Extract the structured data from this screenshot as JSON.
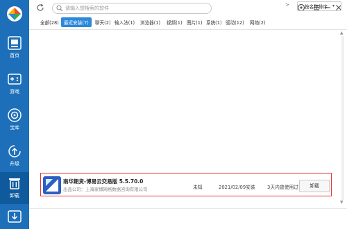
{
  "sidebar": {
    "items": [
      {
        "label": "首页"
      },
      {
        "label": "游戏"
      },
      {
        "label": "宝库"
      },
      {
        "label": "升级"
      },
      {
        "label": "卸载"
      }
    ]
  },
  "search": {
    "placeholder": "请输入想搜索的软件"
  },
  "tabs": [
    "全部(28)",
    "最近安装(7)",
    "聊天(2)",
    "输入法(1)",
    "浏览器(1)",
    "视频(1)",
    "图片(1)",
    "系统(1)",
    "驱动(12)",
    "网络(2)"
  ],
  "tab_more": ">",
  "sort": {
    "label": "按名称排序",
    "chevron": "▾"
  },
  "app": {
    "name": "南华期货-博易云交易版  5.5.70.0",
    "publisher": "出品公司：上海家博网络数据咨询有限公司",
    "size": "未知",
    "install_date": "2021/02/09安装",
    "last_used": "3天内曾使用过",
    "uninstall_label": "卸载"
  },
  "colors": {
    "sidebar": "#1c6fb8",
    "accent": "#2b88db",
    "highlight_border": "#e53333"
  }
}
